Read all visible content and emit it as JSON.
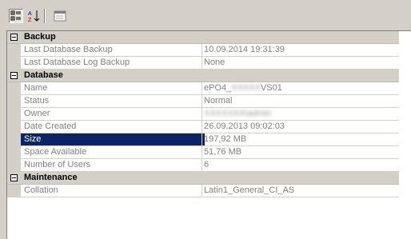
{
  "toolbar": {
    "buttons": [
      {
        "icon": "categorized-icon",
        "pressed": true
      },
      {
        "icon": "alphabetical-sort-icon",
        "pressed": false
      },
      {
        "icon": "property-pages-icon",
        "pressed": false
      }
    ]
  },
  "categories": [
    {
      "name": "Backup",
      "properties": [
        {
          "name": "Last Database Backup",
          "value": "10.09.2014 19:31:39"
        },
        {
          "name": "Last Database Log Backup",
          "value": "None"
        }
      ]
    },
    {
      "name": "Database",
      "properties": [
        {
          "name": "Name",
          "value": "ePO4_",
          "value_hidden": "XXXXX",
          "value_suffix": "VS01"
        },
        {
          "name": "Status",
          "value": "Normal"
        },
        {
          "name": "Owner",
          "value": "",
          "value_hidden": "XXXXXXX\\admin"
        },
        {
          "name": "Date Created",
          "value": "26.09.2013 09:02:03"
        },
        {
          "name": "Size",
          "value": "197,92 MB",
          "selected": true
        },
        {
          "name": "Space Available",
          "value": "51,76 MB"
        },
        {
          "name": "Number of Users",
          "value": "6"
        }
      ]
    },
    {
      "name": "Maintenance",
      "properties": [
        {
          "name": "Collation",
          "value": "Latin1_General_CI_AS"
        }
      ]
    }
  ],
  "colors": {
    "selection": "#0a246a",
    "category_bg": "#d4d0c8",
    "value_text": "#808080"
  }
}
